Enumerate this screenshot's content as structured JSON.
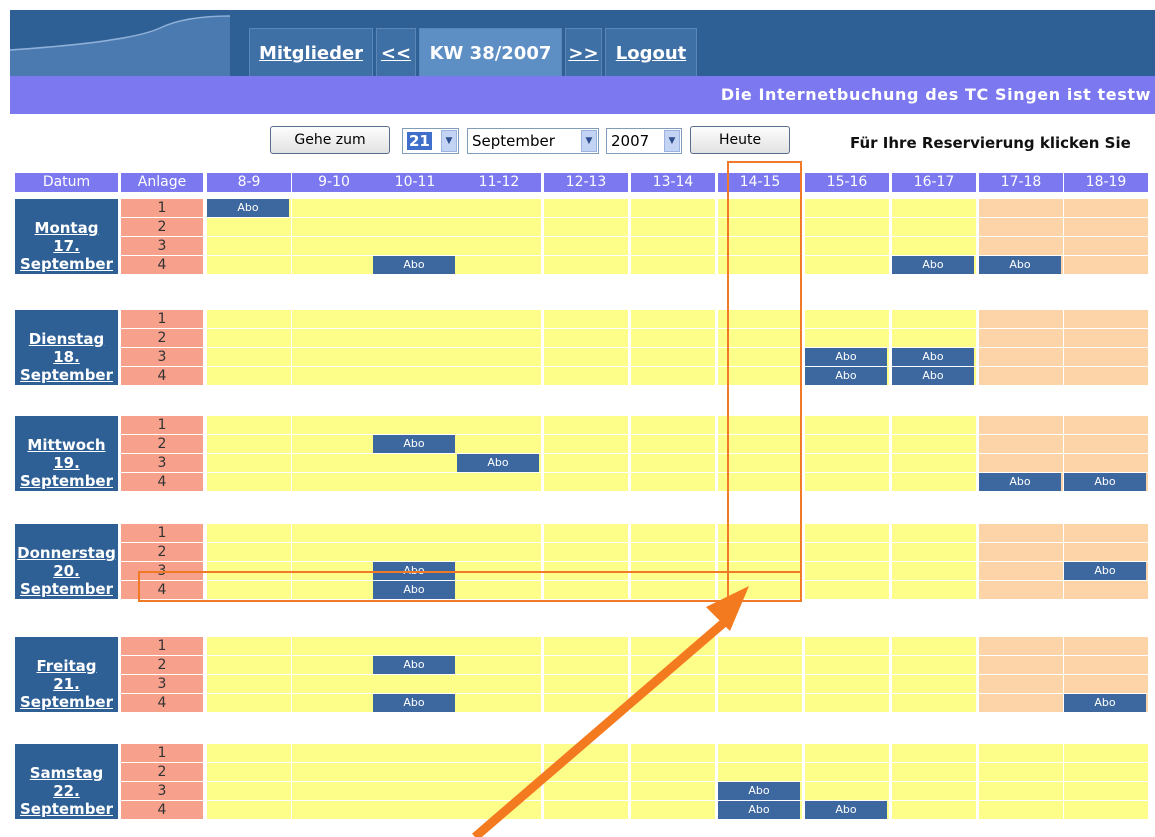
{
  "nav": {
    "tabs": [
      {
        "label": "Mitglieder",
        "link": true
      },
      {
        "label": "<<",
        "link": true
      },
      {
        "label": "KW 38/2007",
        "link": false
      },
      {
        "label": ">>",
        "link": true
      },
      {
        "label": "Logout",
        "link": true
      }
    ]
  },
  "banner": "Die Internetbuchung des TC Singen ist testw",
  "controls": {
    "goto_label": "Gehe zum",
    "day_value": "21",
    "month_value": "September",
    "year_value": "2007",
    "today_label": "Heute",
    "hint": "Für Ihre Reservierung klicken Sie"
  },
  "grid": {
    "header_date": "Datum",
    "header_court": "Anlage",
    "hours": [
      "8-9",
      "9-10",
      "10-11",
      "11-12",
      "12-13",
      "13-14",
      "14-15",
      "15-16",
      "16-17",
      "17-18",
      "18-19"
    ],
    "courts": [
      "1",
      "2",
      "3",
      "4"
    ],
    "booking_label": "Abo",
    "days": [
      {
        "name": "Montag",
        "num": "17.",
        "month": "September",
        "peach_from": 9,
        "bookings": [
          [
            0,
            0
          ],
          [
            3,
            2
          ],
          [
            3,
            8
          ],
          [
            3,
            9
          ]
        ]
      },
      {
        "name": "Dienstag",
        "num": "18.",
        "month": "September",
        "peach_from": 9,
        "bookings": [
          [
            2,
            7
          ],
          [
            2,
            8
          ],
          [
            3,
            7
          ],
          [
            3,
            8
          ]
        ]
      },
      {
        "name": "Mittwoch",
        "num": "19.",
        "month": "September",
        "peach_from": 9,
        "bookings": [
          [
            1,
            2
          ],
          [
            2,
            3
          ],
          [
            3,
            9
          ],
          [
            3,
            10
          ]
        ]
      },
      {
        "name": "Donnerstag",
        "num": "20.",
        "month": "September",
        "peach_from": 9,
        "bookings": [
          [
            2,
            2
          ],
          [
            2,
            10
          ],
          [
            3,
            2
          ]
        ]
      },
      {
        "name": "Freitag",
        "num": "21.",
        "month": "September",
        "peach_from": 9,
        "bookings": [
          [
            1,
            2
          ],
          [
            3,
            2
          ],
          [
            3,
            10
          ]
        ]
      },
      {
        "name": "Samstag",
        "num": "22.",
        "month": "September",
        "peach_from": 99,
        "bookings": [
          [
            2,
            6
          ],
          [
            3,
            6
          ],
          [
            3,
            7
          ]
        ]
      }
    ]
  },
  "colors": {
    "header_blue": "#2e5f95",
    "banner_purple": "#7b78f0",
    "slot_yellow": "#fdfd8a",
    "slot_peach": "#fdd3a8",
    "court_salmon": "#f7a08c",
    "booking_blue": "#3c679f",
    "annotation_orange": "#f07a28"
  }
}
